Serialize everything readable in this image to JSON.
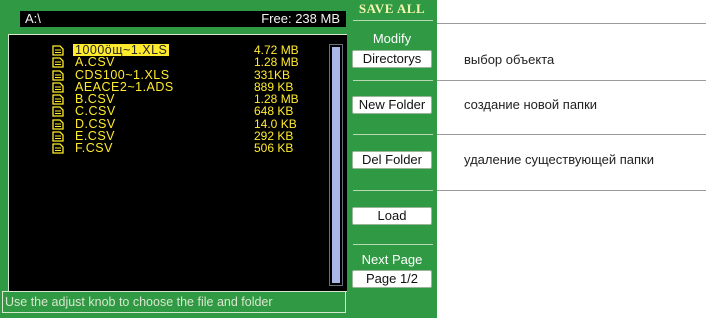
{
  "screen": {
    "path": "A:\\",
    "free": "Free: 238 MB",
    "files": [
      {
        "name": "1000öщ~1.XLS",
        "size": "4.72 MB",
        "selected": true
      },
      {
        "name": "A.CSV",
        "size": "1.28 MB"
      },
      {
        "name": "CDS100~1.XLS",
        "size": "331KB"
      },
      {
        "name": "AEACE2~1.ADS",
        "size": "889 KB"
      },
      {
        "name": "B.CSV",
        "size": "1.28 MB"
      },
      {
        "name": "C.CSV",
        "size": "648 KB"
      },
      {
        "name": "D.CSV",
        "size": "14.0 KB"
      },
      {
        "name": "E.CSV",
        "size": "292 KB"
      },
      {
        "name": "F.CSV",
        "size": "506 KB"
      }
    ],
    "hint": "Use the adjust knob to choose the file and folder"
  },
  "menu": {
    "title": "SAVE ALL",
    "modify_label": "Modify",
    "directorys_button": "Directorys",
    "new_folder_button": "New Folder",
    "del_folder_button": "Del Folder",
    "load_button": "Load",
    "next_page_label": "Next Page",
    "page_button": "Page 1/2"
  },
  "annotations": {
    "select_object": "выбор объекта",
    "create_folder": "создание новой папки",
    "delete_folder": "удаление существующей папки"
  },
  "colors": {
    "panel_green": "#2f9a43",
    "file_text": "#ffeb2d",
    "screen_bg": "#000000"
  }
}
